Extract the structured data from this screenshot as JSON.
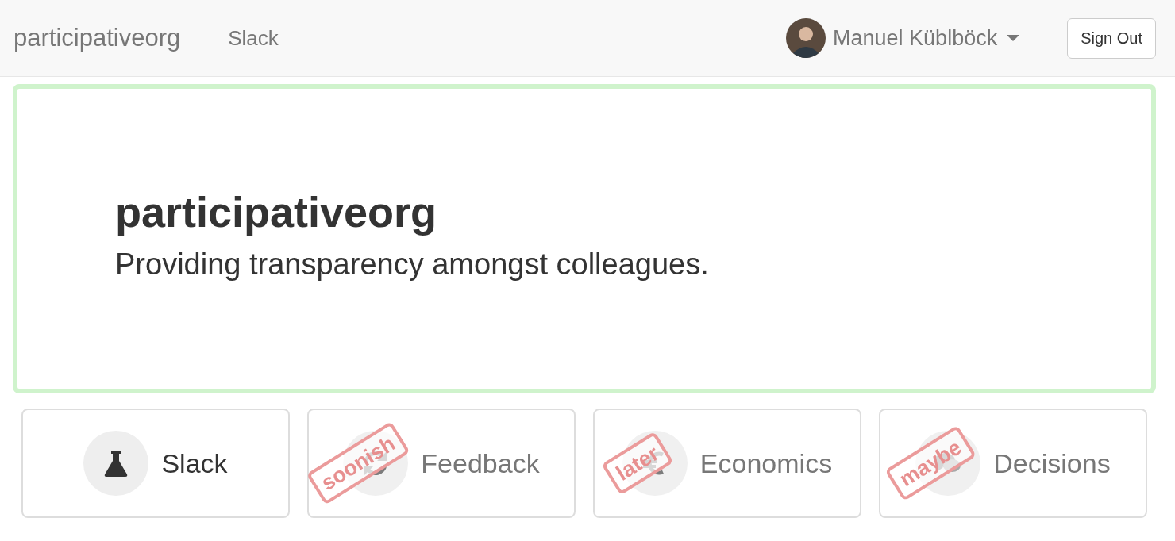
{
  "navbar": {
    "brand": "participativeorg",
    "links": [
      {
        "label": "Slack"
      }
    ],
    "user": {
      "name": "Manuel Küblböck"
    },
    "sign_out": "Sign Out"
  },
  "jumbotron": {
    "title": "participativeorg",
    "subtitle": "Providing transparency amongst colleagues."
  },
  "modules": [
    {
      "label": "Slack",
      "kind": "lab",
      "disabled": false
    },
    {
      "label": "Feedback",
      "kind": "feedback",
      "disabled": true,
      "stamp": "soonish"
    },
    {
      "label": "Economics",
      "kind": "economics",
      "disabled": true,
      "stamp": "later"
    },
    {
      "label": "Decisions",
      "kind": "decisions",
      "disabled": true,
      "stamp": "maybe"
    }
  ]
}
